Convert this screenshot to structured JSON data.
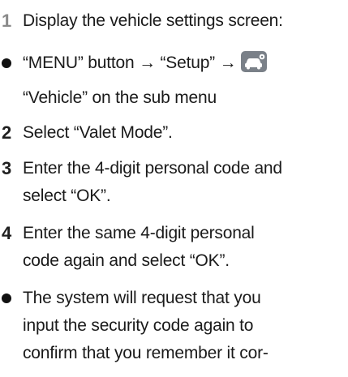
{
  "steps": [
    {
      "number": "1",
      "text": "Display the vehicle settings screen:"
    },
    {
      "number": "2",
      "text": "Select “Valet Mode”."
    },
    {
      "number": "3",
      "line1": "Enter the 4-digit personal code and",
      "line2": "select “OK”."
    },
    {
      "number": "4",
      "line1": "Enter the same 4-digit personal",
      "line2": "code again and select “OK”."
    }
  ],
  "bullets": {
    "menu": {
      "line1": "“MENU” button → “Setup” →",
      "line2": "“Vehicle” on the sub menu",
      "icon": "car-settings-icon"
    },
    "note": {
      "line1": "The system will request that you",
      "line2": "input the security code again to",
      "line3": "confirm that you remember it cor-"
    }
  },
  "colors": {
    "step_number_light": "#8a8a8a",
    "step_number_dark": "#1f1f1f",
    "icon_bg": "#7a8088"
  }
}
